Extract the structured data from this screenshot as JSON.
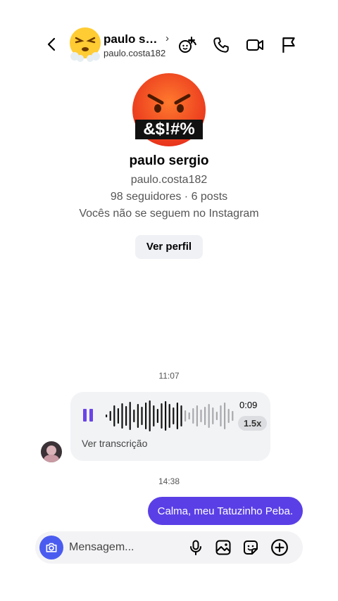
{
  "header": {
    "name": "paulo sergio",
    "chevron": "›",
    "username": "paulo.costa182",
    "icons": [
      "back-icon",
      "effects-icon",
      "phone-icon",
      "video-icon",
      "flag-icon"
    ]
  },
  "profile": {
    "name": "paulo sergio",
    "username": "paulo.costa182",
    "stats": "98 seguidores · 6 posts",
    "follow_status": "Vocês não se seguem no Instagram",
    "view_profile_label": "Ver perfil",
    "avatar_text": "&$!#%"
  },
  "messages": {
    "time1": "11:07",
    "voice": {
      "duration": "0:09",
      "speed": "1.5x",
      "transcript_label": "Ver transcrição",
      "played_fraction": 0.62
    },
    "time2": "14:38",
    "sent_text": "Calma, meu Tatuzinho Peba."
  },
  "composer": {
    "placeholder": "Mensagem...",
    "icons": [
      "camera-icon",
      "microphone-icon",
      "gallery-icon",
      "sticker-icon",
      "add-icon"
    ]
  },
  "colors": {
    "accent": "#5a3fe6",
    "camera": "#4a5cf0",
    "bubble_gray": "#f2f3f5"
  }
}
